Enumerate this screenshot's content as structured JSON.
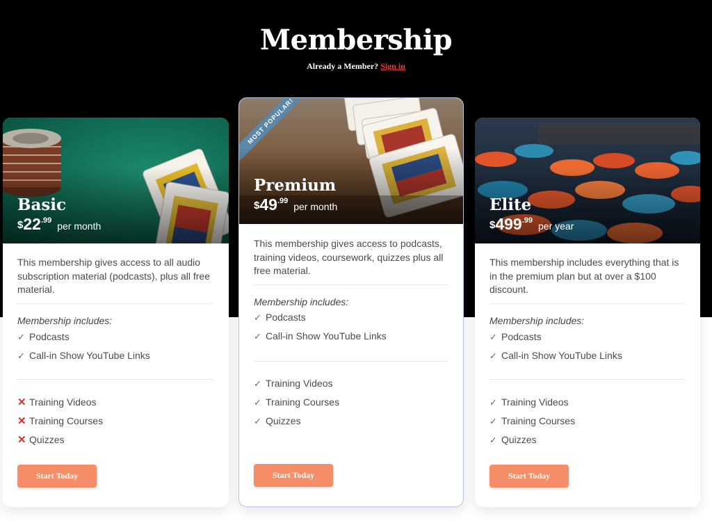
{
  "header": {
    "title": "Membership",
    "already_member": "Already a Member?",
    "signin_link": "Sign in"
  },
  "plans": [
    {
      "name": "Basic",
      "currency": "$",
      "price_whole": "22",
      "price_cents": ".99",
      "period": "per month",
      "description": "This membership gives access to all audio subscription material (podcasts), plus all free material.",
      "includes_title": "Membership includes:",
      "included": [
        "Podcasts",
        "Call-in Show YouTube Links"
      ],
      "extras": [
        "Training Videos",
        "Training Courses",
        "Quizzes"
      ],
      "extras_included": false,
      "cta": "Start Today"
    },
    {
      "name": "Premium",
      "badge": "MOST POPULAR!",
      "currency": "$",
      "price_whole": "49",
      "price_cents": ".99",
      "period": "per month",
      "description": "This membership gives access to podcasts, training videos, coursework, quizzes plus all free material.",
      "includes_title": "Membership includes:",
      "included": [
        "Podcasts",
        "Call-in Show YouTube Links"
      ],
      "extras": [
        "Training Videos",
        "Training Courses",
        "Quizzes"
      ],
      "extras_included": true,
      "cta": "Start Today"
    },
    {
      "name": "Elite",
      "currency": "$",
      "price_whole": "499",
      "price_cents": ".99",
      "period": "per year",
      "description": "This membership includes everything that is in the premium plan but at over a $100 discount.",
      "includes_title": "Membership includes:",
      "included": [
        "Podcasts",
        "Call-in Show YouTube Links"
      ],
      "extras": [
        "Training Videos",
        "Training Courses",
        "Quizzes"
      ],
      "extras_included": true,
      "cta": "Start Today"
    }
  ],
  "icons": {
    "included": "check-icon",
    "excluded": "cross-icon"
  },
  "colors": {
    "cta": "#f58d67",
    "signin_link": "#e2433d",
    "cross": "#d9302e",
    "badge": "#5b87a8"
  }
}
